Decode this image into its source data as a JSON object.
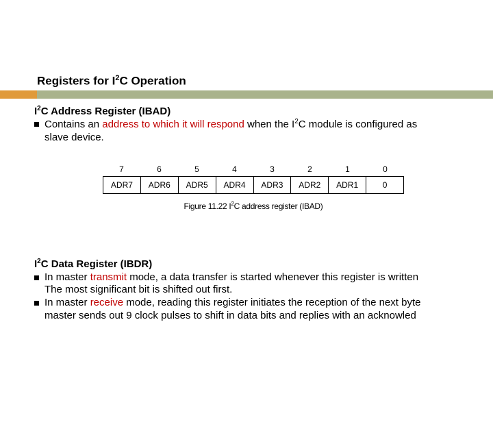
{
  "title": {
    "pre": "Registers for I",
    "sup": "2",
    "post": "C Operation"
  },
  "sec1": {
    "heading_pre": "I",
    "heading_sup": "2",
    "heading_post": "C Address Register (IBAD)",
    "bullet_pre": "Contains an ",
    "bullet_red": "address to which it will respond",
    "bullet_mid": " when the I",
    "bullet_sup": "2",
    "bullet_post": "C module is configured as",
    "bullet_line2": "slave device."
  },
  "register": {
    "bits": [
      "7",
      "6",
      "5",
      "4",
      "3",
      "2",
      "1",
      "0"
    ],
    "names": [
      "ADR7",
      "ADR6",
      "ADR5",
      "ADR4",
      "ADR3",
      "ADR2",
      "ADR1",
      "0"
    ],
    "caption_pre": "Figure 11.22 I",
    "caption_sup": "2",
    "caption_post": "C address register (IBAD)"
  },
  "sec2": {
    "heading_pre": "I",
    "heading_sup": "2",
    "heading_post": "C Data Register (IBDR)",
    "b1_pre": "In master ",
    "b1_red": "transmit",
    "b1_post": " mode, a data transfer is started whenever this register is written",
    "b1_line2": "The most significant bit is shifted out first.",
    "b2_pre": "In master ",
    "b2_red": "receive",
    "b2_post": " mode, reading this register initiates the reception of the next byte",
    "b2_line2": "master sends out 9 clock pulses to shift in data bits and replies with an acknowled"
  }
}
